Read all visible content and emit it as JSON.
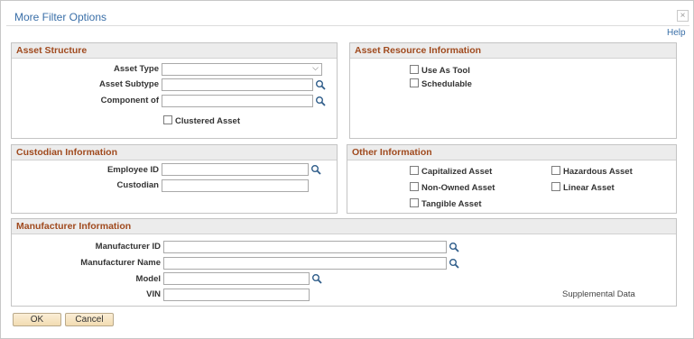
{
  "dialog": {
    "title": "More Filter Options",
    "close_glyph": "×",
    "help": "Help"
  },
  "asset_structure": {
    "header": "Asset Structure",
    "asset_type_label": "Asset Type",
    "asset_type_value": "",
    "asset_subtype_label": "Asset Subtype",
    "asset_subtype_value": "",
    "component_of_label": "Component of",
    "component_of_value": "",
    "clustered_label": "Clustered Asset",
    "clustered_checked": false
  },
  "asset_resource": {
    "header": "Asset Resource Information",
    "use_as_tool_label": "Use As Tool",
    "schedulable_label": "Schedulable"
  },
  "custodian": {
    "header": "Custodian Information",
    "employee_id_label": "Employee ID",
    "employee_id_value": "",
    "custodian_label": "Custodian",
    "custodian_value": ""
  },
  "other": {
    "header": "Other Information",
    "capitalized_label": "Capitalized Asset",
    "hazardous_label": "Hazardous Asset",
    "non_owned_label": "Non-Owned Asset",
    "linear_label": "Linear Asset",
    "tangible_label": "Tangible Asset"
  },
  "manufacturer": {
    "header": "Manufacturer Information",
    "manufacturer_id_label": "Manufacturer ID",
    "manufacturer_id_value": "",
    "manufacturer_name_label": "Manufacturer Name",
    "manufacturer_name_value": "",
    "model_label": "Model",
    "model_value": "",
    "vin_label": "VIN",
    "vin_value": "",
    "supplemental": "Supplemental Data"
  },
  "buttons": {
    "ok": "OK",
    "cancel": "Cancel"
  },
  "colors": {
    "title": "#3a6fa8",
    "section_header_text": "#a04a1e",
    "section_header_bg": "#ececec",
    "button_bg": "#f2dcb2"
  }
}
